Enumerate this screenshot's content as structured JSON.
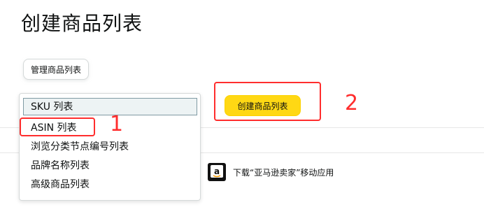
{
  "page": {
    "title": "创建商品列表"
  },
  "toolbar": {
    "manage_button_label": "管理商品列表"
  },
  "list_type_dropdown": {
    "selected": "SKU 列表",
    "options": [
      "SKU 列表",
      "ASIN 列表",
      "浏览分类节点编号列表",
      "品牌名称列表",
      "高级商品列表"
    ]
  },
  "actions": {
    "create_button_label": "创建商品列表"
  },
  "app_promo": {
    "text": "下载“亚马逊卖家”移动应用",
    "icon": "amazon-app-icon"
  },
  "annotations": {
    "step_1": "1",
    "step_2": "2",
    "color": "#ff2d2d"
  },
  "colors": {
    "primary_button": "#ffd814",
    "selected_option_bg": "#edf3f4"
  }
}
